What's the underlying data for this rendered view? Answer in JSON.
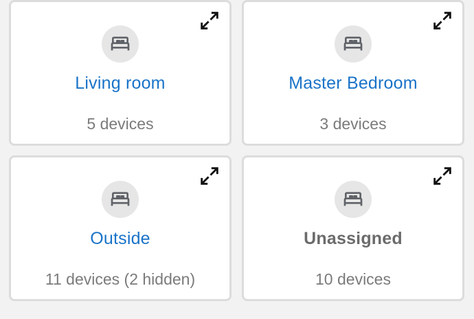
{
  "rooms": [
    {
      "name": "Living room",
      "devices": "5 devices",
      "link": true,
      "icon": "bed-icon"
    },
    {
      "name": "Master Bedroom",
      "devices": "3 devices",
      "link": true,
      "icon": "bed-icon"
    },
    {
      "name": "Outside",
      "devices": "11 devices (2 hidden)",
      "link": true,
      "icon": "bed-icon"
    },
    {
      "name": "Unassigned",
      "devices": "10 devices",
      "link": false,
      "icon": "bed-icon"
    }
  ],
  "colors": {
    "link": "#1a73c8",
    "muted_title": "#6b6b6b",
    "count_text": "#7b7b7b",
    "card_border": "#dcdcdc",
    "icon_bg": "#e6e6e6",
    "icon_fg": "#5f6368",
    "page_bg": "#f2f2f2"
  },
  "icons": {
    "expand": "expand-icon",
    "room": "bed-icon"
  }
}
